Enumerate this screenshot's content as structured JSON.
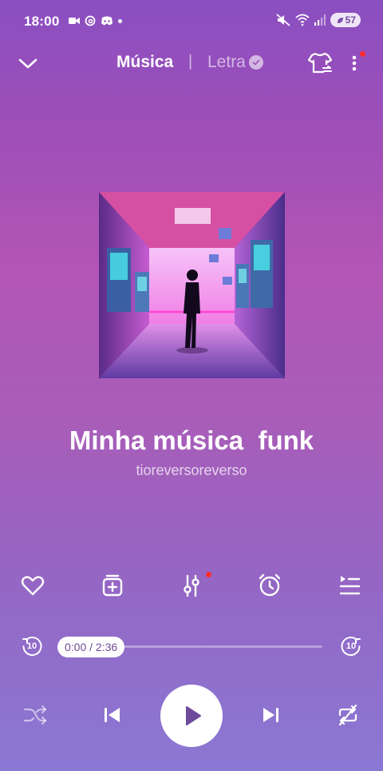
{
  "status_bar": {
    "time": "18:00",
    "battery": "57"
  },
  "header": {
    "tab_music": "Música",
    "separator": "|",
    "tab_lyrics": "Letra"
  },
  "song": {
    "title": "Minha música  funk",
    "artist": "tioreversoreverso"
  },
  "playback": {
    "time_display": "0:00 / 2:36",
    "progress": 0,
    "rewind_seconds": "10",
    "forward_seconds": "10"
  },
  "icons": {
    "back": "chevron-down-icon",
    "theme": "tshirt-icon",
    "more": "more-vertical-icon",
    "favorite": "heart-icon",
    "add_playlist": "add-to-playlist-icon",
    "equalizer": "equalizer-icon",
    "sleep_timer": "alarm-clock-icon",
    "queue": "queue-icon",
    "shuffle": "shuffle-icon",
    "previous": "skip-previous-icon",
    "play": "play-icon",
    "next": "skip-next-icon",
    "repeat": "repeat-off-icon"
  },
  "colors": {
    "accent_red": "#ff2d2d",
    "pill_text": "#6e4a9a"
  }
}
